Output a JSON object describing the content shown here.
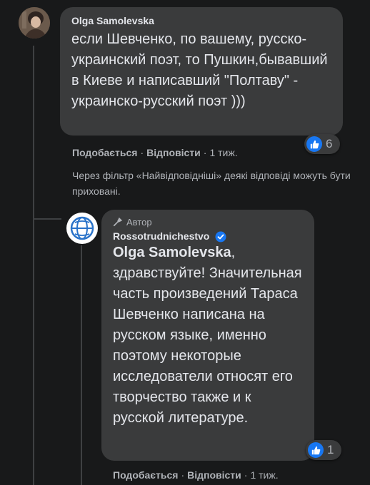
{
  "comment1": {
    "author": "Olga Samolevska",
    "text": "если Шевченко, по вашему, русско-украинский поэт, то Пушкин,бывавший в Киеве и написавший \"Полтаву\" - украинско-русский поэт )))",
    "reaction_count": "6",
    "actions": {
      "like": "Подобається",
      "reply": "Відповісти",
      "time": "1 тиж."
    }
  },
  "filter_note": "Через фільтр «Найвідповідніші» деякі відповіді можуть бути приховані.",
  "reply1": {
    "badge": "Автор",
    "author": "Rossotrudnichestvo",
    "mention": "Olga Samolevska",
    "text": ", здравствуйте! Значительная часть произведений Тараса Шевченко написана на русском языке, именно поэтому некоторые исследователи относят его творчество также и к русской литературе.",
    "reaction_count": "1",
    "actions": {
      "like": "Подобається",
      "reply": "Відповісти",
      "time": "1 тиж."
    }
  },
  "colors": {
    "like_blue": "#1877f2",
    "bubble": "#3a3b3c",
    "background": "#18191a"
  }
}
